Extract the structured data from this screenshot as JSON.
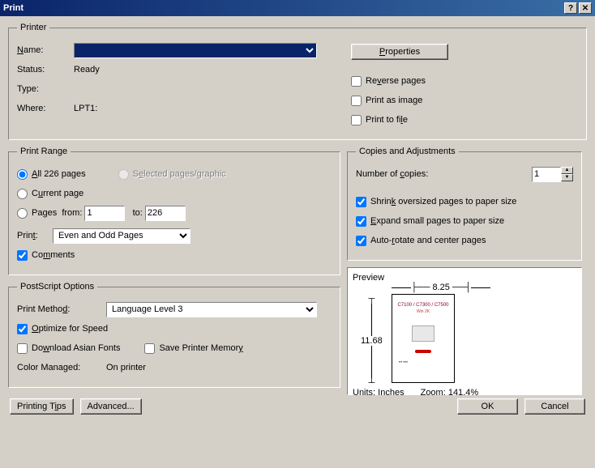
{
  "title": "Print",
  "printer": {
    "legend": "Printer",
    "name_label": "Name:",
    "name_value": "",
    "properties_btn": "Properties",
    "status_label": "Status:",
    "status_value": "Ready",
    "type_label": "Type:",
    "type_value": "",
    "where_label": "Where:",
    "where_value": "LPT1:",
    "reverse_pages": "Reverse pages",
    "print_as_image": "Print as image",
    "print_to_file": "Print to file"
  },
  "range": {
    "legend": "Print Range",
    "all_label": "All 226 pages",
    "selected_label": "Selected pages/graphic",
    "current_label": "Current page",
    "pages_label": "Pages",
    "from_label": "from:",
    "from_value": "1",
    "to_label": "to:",
    "to_value": "226",
    "print_label": "Print:",
    "print_value": "Even and Odd Pages",
    "comments_label": "Comments"
  },
  "copies": {
    "legend": "Copies and Adjustments",
    "number_label": "Number of copies:",
    "number_value": "1",
    "shrink_label": "Shrink oversized pages to paper size",
    "expand_label": "Expand small pages to paper size",
    "autorotate_label": "Auto-rotate and center pages"
  },
  "postscript": {
    "legend": "PostScript Options",
    "method_label": "Print Method:",
    "method_value": "Language Level 3",
    "optimize_label": "Optimize for Speed",
    "download_label": "Download Asian Fonts",
    "savemem_label": "Save Printer Memory",
    "colormanaged_label": "Color Managed:",
    "colormanaged_value": "On printer"
  },
  "preview": {
    "label": "Preview",
    "width": "8.25",
    "height": "11.68",
    "units_label": "Units: Inches",
    "zoom_label": "Zoom: 141.4%"
  },
  "buttons": {
    "printing_tips": "Printing Tips",
    "advanced": "Advanced...",
    "ok": "OK",
    "cancel": "Cancel"
  }
}
